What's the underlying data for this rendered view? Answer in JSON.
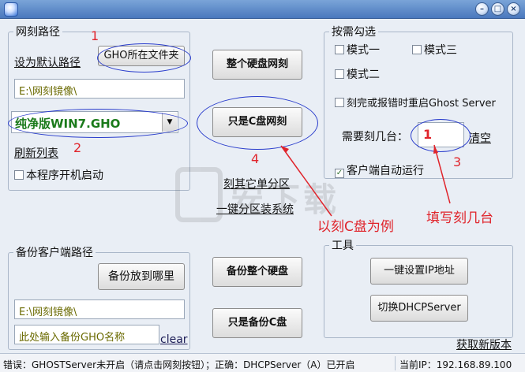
{
  "window": {
    "minimize": "–",
    "maximize": "□",
    "close": "×"
  },
  "net_path": {
    "legend": "网刻路径",
    "set_default": "设为默认路径",
    "gho_folder_button": "GHO所在文件夹",
    "path_value": "E:\\网刻镜像\\",
    "gho_selected": "纯净版WIN7.GHO",
    "refresh": "刷新列表",
    "autostart": "本程序开机启动"
  },
  "center": {
    "whole_disk_button": "整个硬盘网刻",
    "c_drive_button": "只是C盘网刻",
    "other_partition": "刻其它单分区",
    "one_key_partition": "一键分区装系统",
    "backup_whole_button": "备份整个硬盘",
    "backup_c_button": "只是备份C盘"
  },
  "options": {
    "legend": "按需勾选",
    "mode1": "模式一",
    "mode3": "模式三",
    "mode2": "模式二",
    "restart_ghost": "刻完或报错时重启Ghost Server",
    "count_label": "需要刻几台：",
    "count_value": "1",
    "clear": "清空",
    "client_autorun": "客户端自动运行",
    "check_mark": "✓"
  },
  "backup": {
    "legend": "备份客户端路径",
    "where_button": "备份放到哪里",
    "path_value": "E:\\网刻镜像\\",
    "name_placeholder": "此处输入备份GHO名称",
    "clear": "clear"
  },
  "tools": {
    "legend": "工具",
    "set_ip_button": "一键设置IP地址",
    "dhcp_button": "切换DHCPServer"
  },
  "get_new_version": "获取新版本",
  "status": {
    "left": "错误：GHOSTServer未开启（请点击网刻按钮）；正确：DHCPServer（A）已开启",
    "right": "当前IP：192.168.89.100"
  },
  "annotations": {
    "n1": "1",
    "n2": "2",
    "n3": "3",
    "n4": "4",
    "example": "以刻C盘为例",
    "fill_count": "填写刻几台"
  },
  "colors": {
    "annotation": "#e0242b",
    "ellipse": "#2a3dcc",
    "gho_text": "#1a7a1a"
  }
}
